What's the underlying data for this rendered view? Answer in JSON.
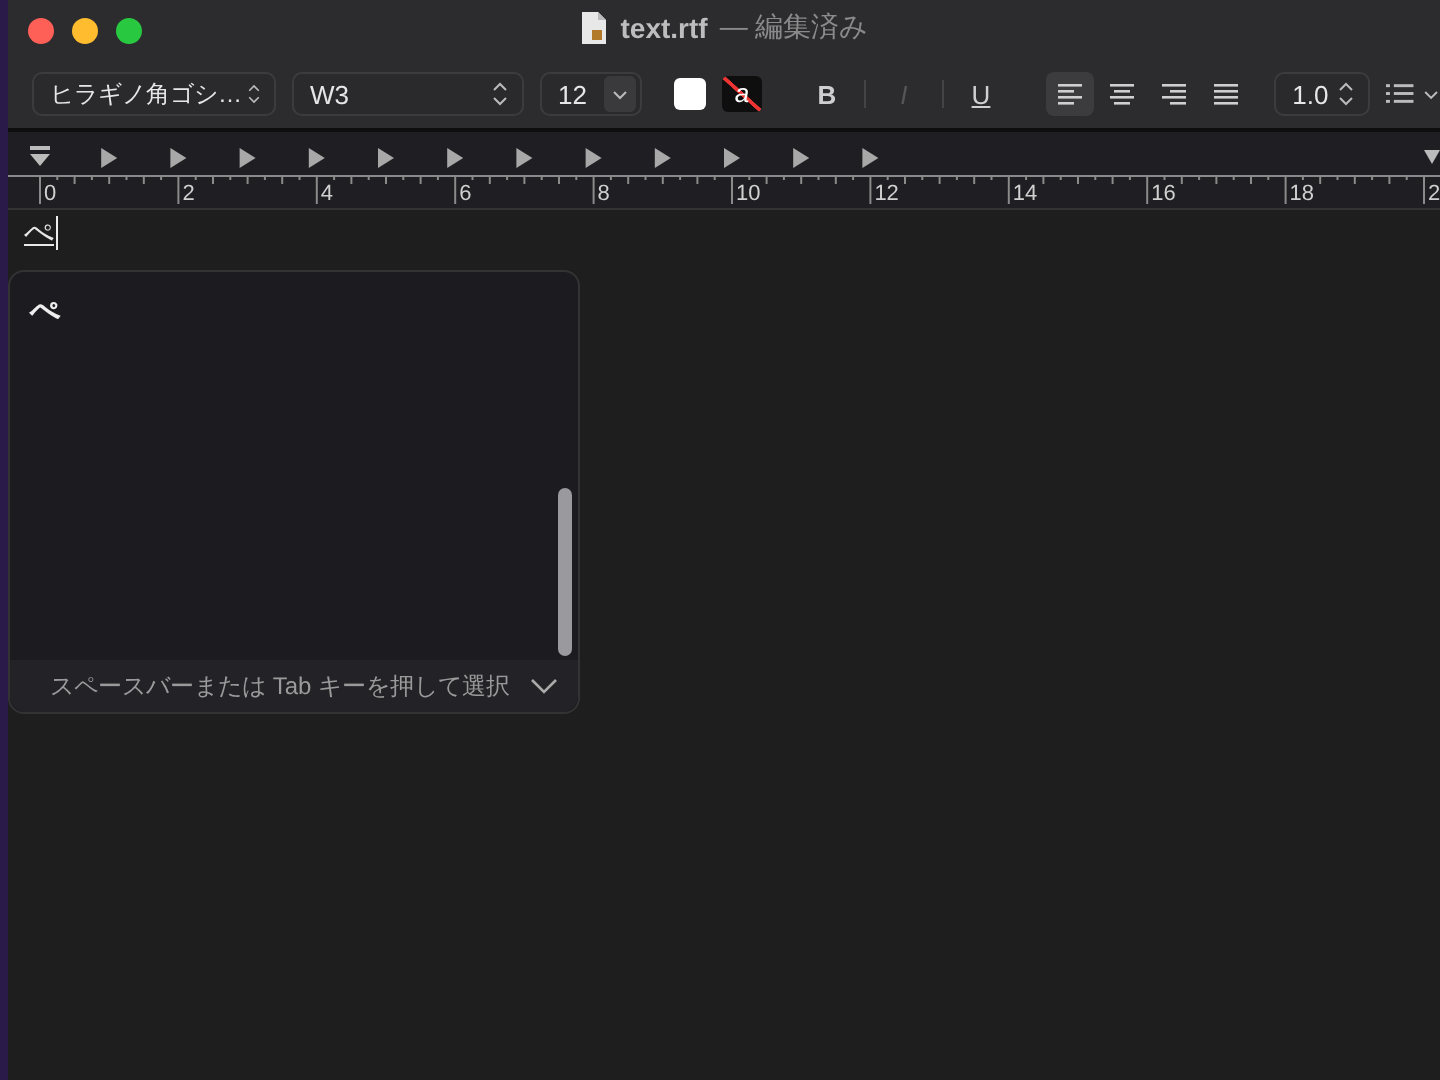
{
  "window": {
    "title": "text.rtf",
    "status": "— 編集済み"
  },
  "toolbar": {
    "font_family": "ヒラギノ角ゴシ…",
    "font_style": "W3",
    "font_size": "12",
    "line_spacing": "1.0",
    "background_color_label": "a",
    "style_buttons": [
      {
        "kind": "bold",
        "label": "B",
        "disabled": false
      },
      {
        "kind": "italic",
        "label": "I",
        "disabled": true
      },
      {
        "kind": "underline",
        "label": "U",
        "disabled": false
      }
    ],
    "alignments": [
      {
        "kind": "left",
        "selected": true
      },
      {
        "kind": "center",
        "selected": false
      },
      {
        "kind": "right",
        "selected": false
      },
      {
        "kind": "justify",
        "selected": false
      }
    ]
  },
  "ruler": {
    "labels": [
      "0",
      "2",
      "4",
      "6",
      "8",
      "10",
      "12",
      "14",
      "16",
      "18",
      "2"
    ]
  },
  "document": {
    "composing_text": "ぺ"
  },
  "candidates": {
    "items": [
      {
        "label": "ぺ",
        "selected": false
      }
    ],
    "hint": "スペースバーまたは Tab キーを押して選択"
  }
}
